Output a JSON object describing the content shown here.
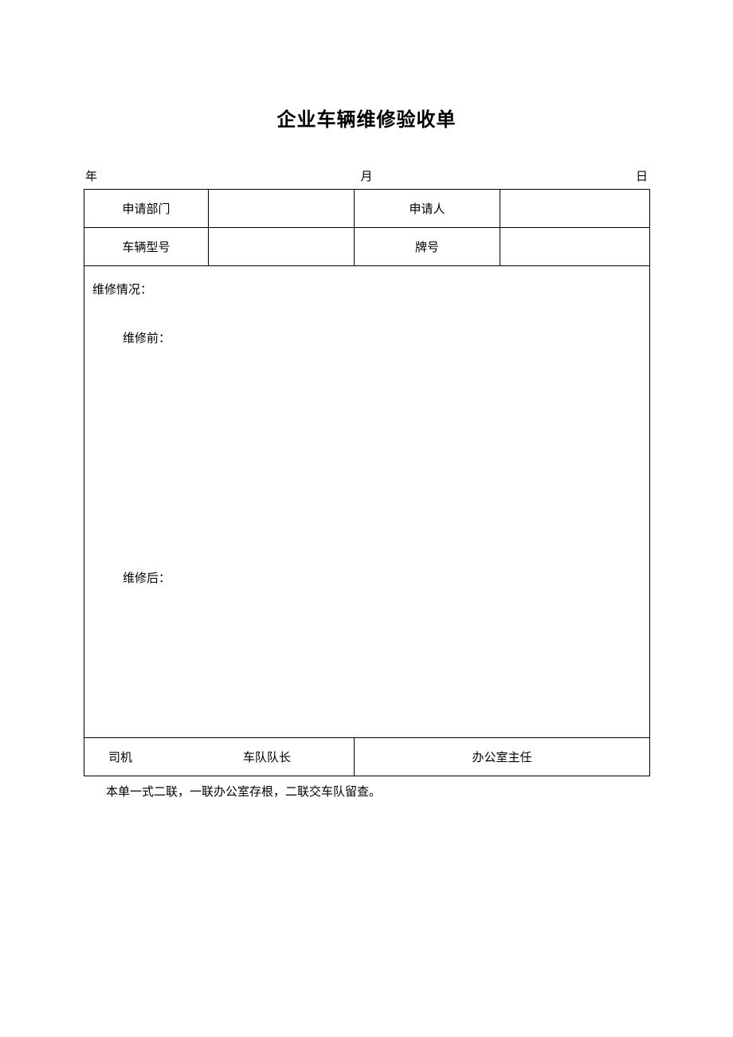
{
  "title": "企业车辆维修验收单",
  "date": {
    "year_label": "年",
    "month_label": "月",
    "day_label": "日"
  },
  "fields": {
    "dept_label": "申请部门",
    "dept_value": "",
    "applicant_label": "申请人",
    "applicant_value": "",
    "model_label": "车辆型号",
    "model_value": "",
    "plate_label": "牌号",
    "plate_value": ""
  },
  "detail": {
    "section_label": "维修情况：",
    "before_label": "维修前：",
    "after_label": "维修后："
  },
  "signatures": {
    "driver_label": "司机",
    "captain_label": "车队队长",
    "director_label": "办公室主任"
  },
  "note": "本单一式二联，一联办公室存根，二联交车队留查。"
}
